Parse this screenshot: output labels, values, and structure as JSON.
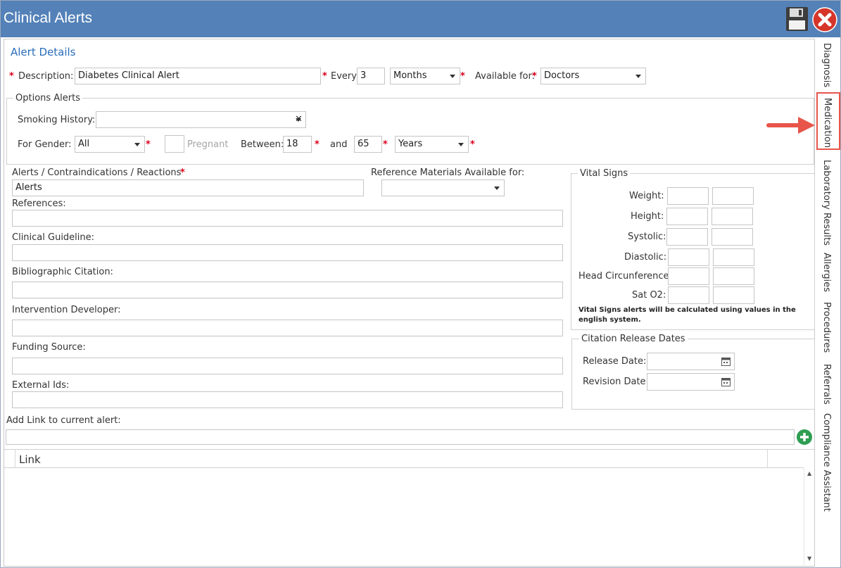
{
  "window": {
    "title": "Clinical Alerts"
  },
  "section_title": "Alert Details",
  "description": {
    "label": "Description:",
    "value": "Diabetes Clinical Alert"
  },
  "every": {
    "label": "Every:",
    "value": "3",
    "unit": "Months"
  },
  "available_for": {
    "label": "Available for:",
    "value": "Doctors"
  },
  "options_alerts": {
    "legend": "Options Alerts",
    "smoking_label": "Smoking History:",
    "smoking_value": "",
    "gender_label": "For Gender:",
    "gender_value": "All",
    "pregnant_label": "Pregnant",
    "between_label": "Between:",
    "between_from": "18",
    "and_label": "and",
    "between_to": "65",
    "age_unit": "Years"
  },
  "alerts_field": {
    "label": "Alerts / Contraindications / Reactions",
    "value": "Alerts"
  },
  "reference_materials": {
    "label": "Reference Materials Available for:",
    "value": ""
  },
  "references_label": "References:",
  "clinical_guideline_label": "Clinical Guideline:",
  "bibliographic_label": "Bibliographic Citation:",
  "intervention_label": "Intervention Developer:",
  "funding_label": "Funding Source:",
  "external_ids_label": "External Ids:",
  "vital_signs": {
    "legend": "Vital Signs",
    "rows": [
      {
        "label": "Weight:"
      },
      {
        "label": "Height:"
      },
      {
        "label": "Systolic:"
      },
      {
        "label": "Diastolic:"
      },
      {
        "label": "Head Circunference:"
      },
      {
        "label": "Sat O2:"
      }
    ],
    "note": "Vital Signs alerts will be calculated using values in the english system."
  },
  "citation_dates": {
    "legend": "Citation Release Dates",
    "release_label": "Release Date:",
    "revision_label": "Revision Date:"
  },
  "add_link": {
    "label": "Add Link to current alert:",
    "value": ""
  },
  "link_table": {
    "header": "Link",
    "rows": []
  },
  "side_tabs": [
    "Diagnosis",
    "Medication",
    "Laboratory Results",
    "Allergies",
    "Procedures",
    "Referrals",
    "Compliance Assistant"
  ],
  "active_tab": "Medication",
  "colors": {
    "titlebar": "#5381b8",
    "accent": "#2a6ebb",
    "required": "#d9001b",
    "highlight": "#e8554a"
  },
  "icons": {
    "save": "floppy-disk-icon",
    "close": "close-icon",
    "add": "plus-circle-icon",
    "calendar": "calendar-icon"
  }
}
